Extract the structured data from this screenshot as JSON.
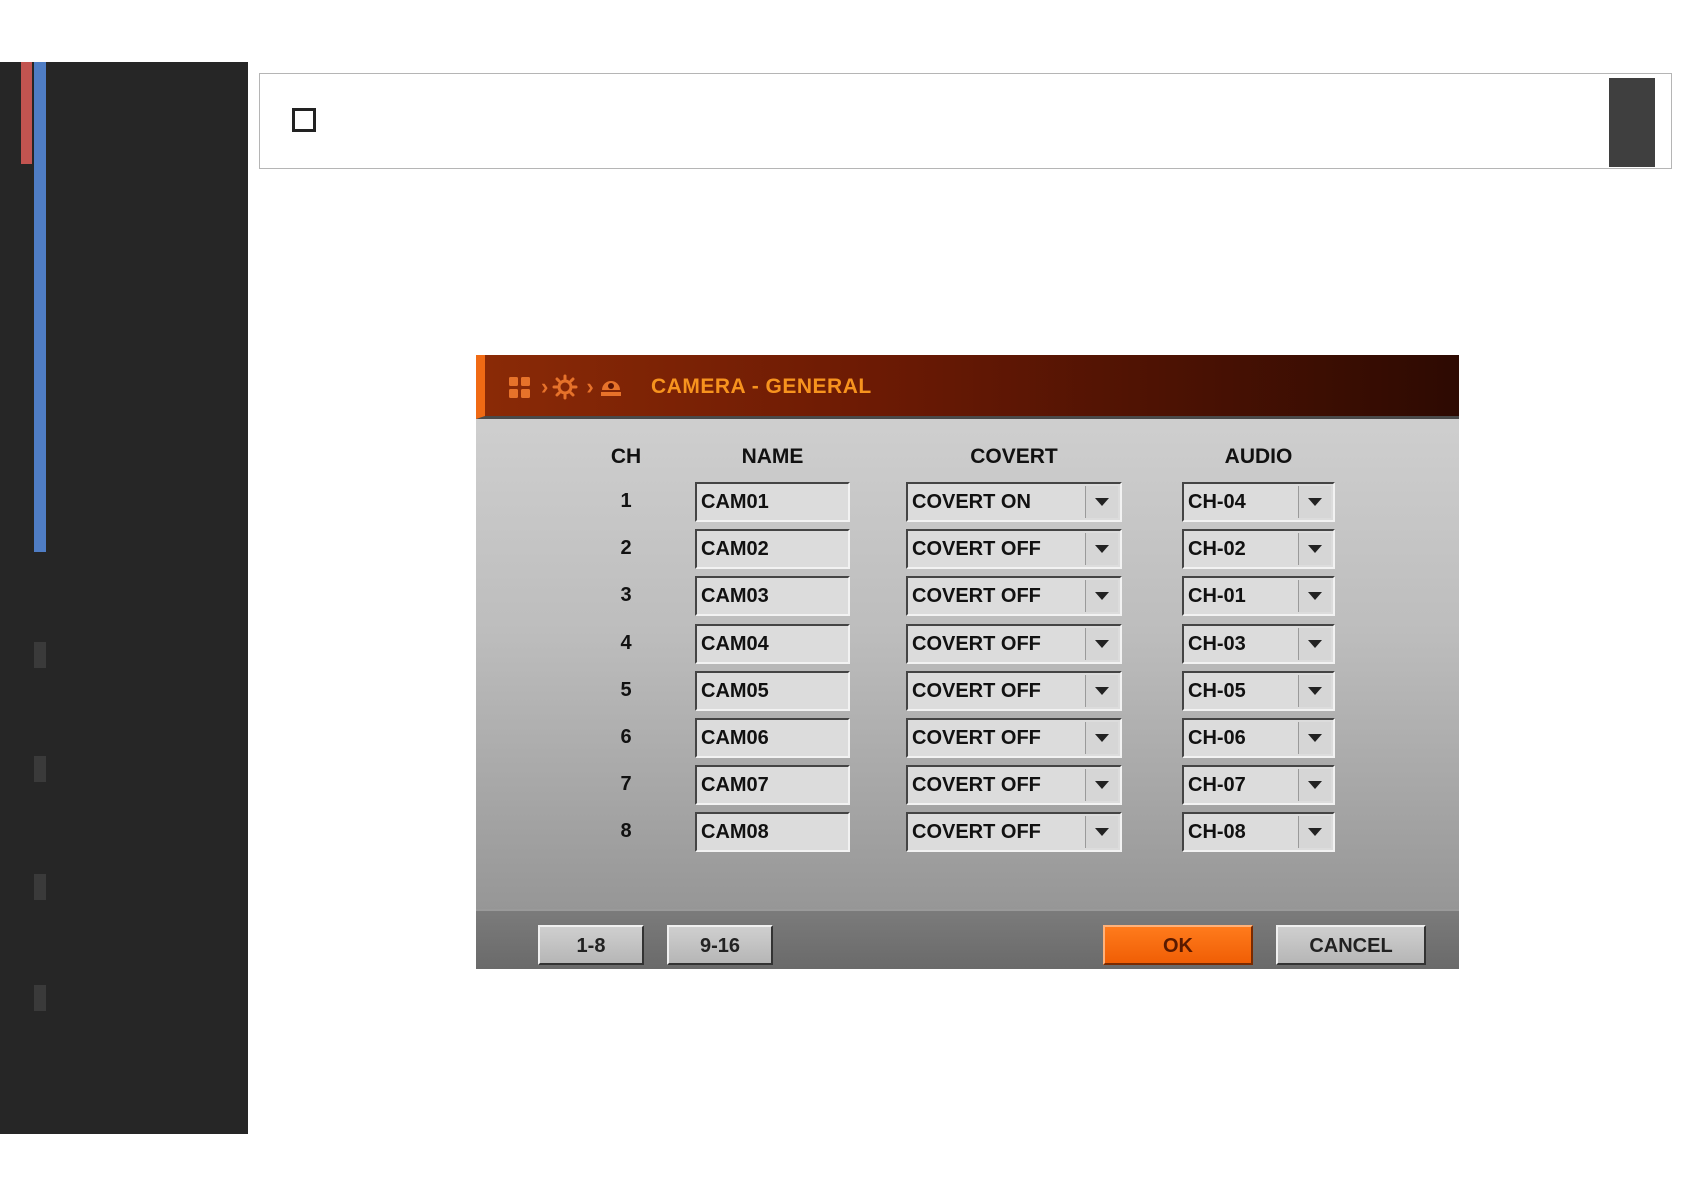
{
  "dialog": {
    "title": "CAMERA - GENERAL",
    "breadcrumb_icons": [
      "grid-icon",
      "gear-icon",
      "camera-icon"
    ],
    "columns": {
      "ch": "CH",
      "name": "NAME",
      "covert": "COVERT",
      "audio": "AUDIO"
    },
    "rows": [
      {
        "ch": "1",
        "name": "CAM01",
        "covert": "COVERT ON",
        "audio": "CH-04"
      },
      {
        "ch": "2",
        "name": "CAM02",
        "covert": "COVERT OFF",
        "audio": "CH-02"
      },
      {
        "ch": "3",
        "name": "CAM03",
        "covert": "COVERT OFF",
        "audio": "CH-01"
      },
      {
        "ch": "4",
        "name": "CAM04",
        "covert": "COVERT OFF",
        "audio": "CH-03"
      },
      {
        "ch": "5",
        "name": "CAM05",
        "covert": "COVERT OFF",
        "audio": "CH-05"
      },
      {
        "ch": "6",
        "name": "CAM06",
        "covert": "COVERT OFF",
        "audio": "CH-06"
      },
      {
        "ch": "7",
        "name": "CAM07",
        "covert": "COVERT OFF",
        "audio": "CH-07"
      },
      {
        "ch": "8",
        "name": "CAM08",
        "covert": "COVERT OFF",
        "audio": "CH-08"
      }
    ],
    "footer": {
      "page1_label": "1-8",
      "page2_label": "9-16",
      "ok_label": "OK",
      "cancel_label": "CANCEL"
    }
  },
  "colors": {
    "accent": "#f06a14",
    "title_text": "#f7931e",
    "sidebar_bg": "#262626",
    "sidebar_red": "#c25450",
    "sidebar_blue": "#4f7dc4"
  }
}
